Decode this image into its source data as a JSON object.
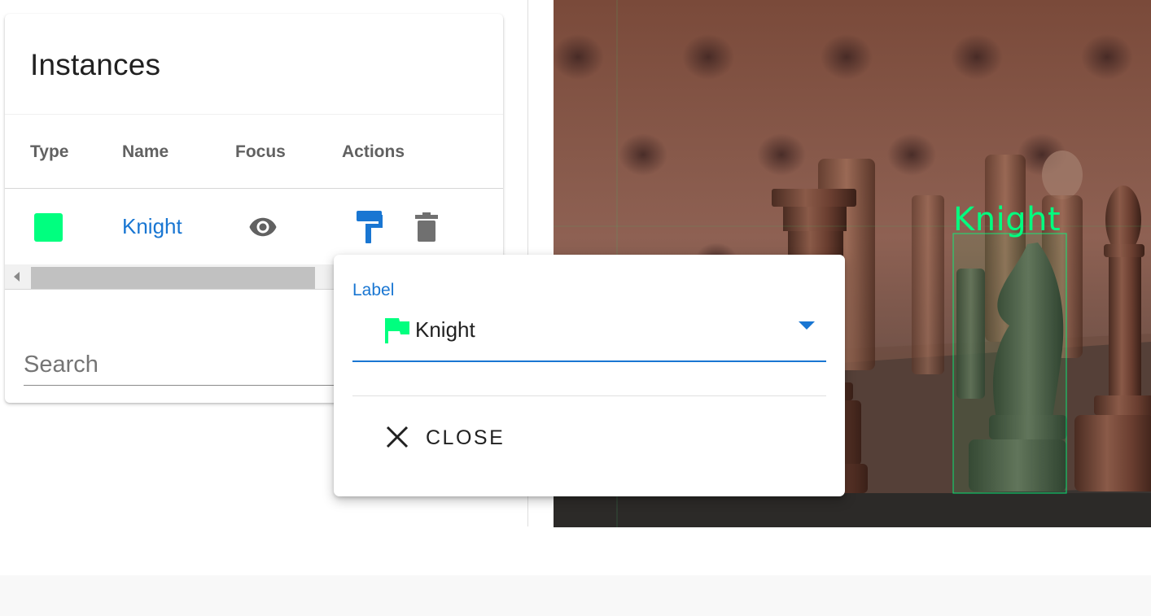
{
  "instances_panel": {
    "title": "Instances",
    "columns": [
      "Type",
      "Name",
      "Focus",
      "Actions"
    ],
    "rows": [
      {
        "type_color": "#00ff7f",
        "name": "Knight",
        "focus_icon": "eye-icon",
        "action_icons": [
          "paint-roller-icon",
          "trash-icon"
        ]
      }
    ],
    "search": {
      "placeholder": "Search",
      "value": ""
    }
  },
  "viewer": {
    "annotation": {
      "label": "Knight",
      "color": "#00ff7f"
    }
  },
  "label_popup": {
    "field_label": "Label",
    "selected": {
      "value": "Knight",
      "icon": "flag-icon",
      "icon_color": "#00ff7f"
    },
    "close_label": "CLOSE",
    "close_icon": "close-icon"
  },
  "colors": {
    "accent": "#1976d2",
    "annotation": "#00ff7f"
  }
}
